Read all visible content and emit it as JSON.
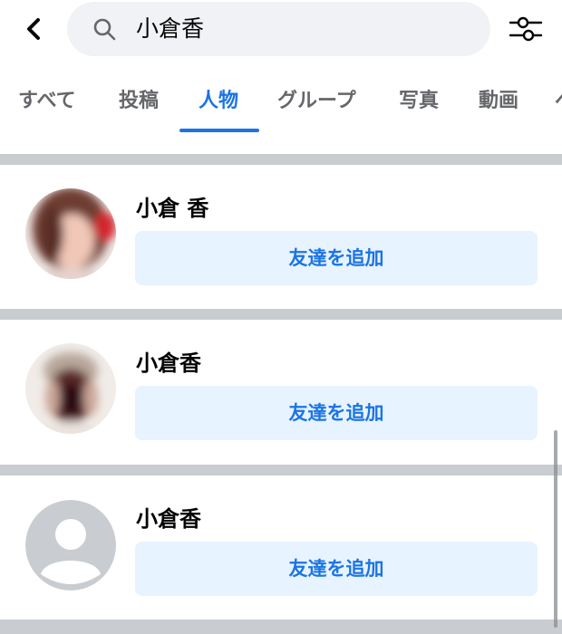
{
  "header": {
    "back_icon": "chevron-left-icon",
    "search": {
      "icon": "search-icon",
      "query": "小倉香"
    },
    "filter_icon": "sliders-icon"
  },
  "tabs": [
    {
      "label": "すべて",
      "active": false
    },
    {
      "label": "投稿",
      "active": false
    },
    {
      "label": "人物",
      "active": true
    },
    {
      "label": "グループ",
      "active": false
    },
    {
      "label": "写真",
      "active": false
    },
    {
      "label": "動画",
      "active": false
    },
    {
      "label": "ペ",
      "active": false
    }
  ],
  "results": [
    {
      "name": "小倉 香",
      "button": "友達を追加",
      "avatar": "blurred-photo"
    },
    {
      "name": "小倉香",
      "button": "友達を追加",
      "avatar": "blurred-photo"
    },
    {
      "name": "小倉香",
      "button": "友達を追加",
      "avatar": "default-avatar"
    }
  ],
  "colors": {
    "accent": "#1b74e4",
    "button_bg": "#e7f3ff",
    "separator": "#c9ccd1",
    "search_bg": "#f0f2f5"
  }
}
